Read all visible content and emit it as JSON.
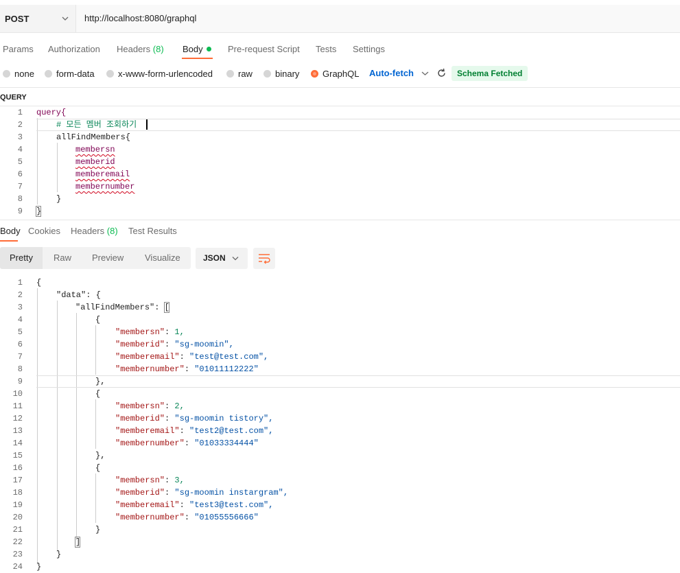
{
  "request": {
    "method": "POST",
    "url": "http://localhost:8080/graphql"
  },
  "tabs": [
    {
      "label": "Params"
    },
    {
      "label": "Authorization"
    },
    {
      "label": "Headers",
      "count": "(8)"
    },
    {
      "label": "Body"
    },
    {
      "label": "Pre-request Script"
    },
    {
      "label": "Tests"
    },
    {
      "label": "Settings"
    }
  ],
  "body_types": [
    "none",
    "form-data",
    "x-www-form-urlencoded",
    "raw",
    "binary",
    "GraphQL"
  ],
  "selected_body_type": "GraphQL",
  "auto_fetch": "Auto-fetch",
  "schema_badge": "Schema Fetched",
  "query_label": "QUERY",
  "query_lines": [
    {
      "n": "1",
      "text": "query{"
    },
    {
      "n": "2",
      "text": "# 모든 멤버 조회하기"
    },
    {
      "n": "3",
      "text": "allFindMembers{"
    },
    {
      "n": "4",
      "text": "membersn"
    },
    {
      "n": "5",
      "text": "memberid"
    },
    {
      "n": "6",
      "text": "memberemail"
    },
    {
      "n": "7",
      "text": "membernumber"
    },
    {
      "n": "8",
      "text": "}"
    },
    {
      "n": "9",
      "text": "}"
    }
  ],
  "response_tabs": [
    {
      "label": "Body"
    },
    {
      "label": "Cookies"
    },
    {
      "label": "Headers",
      "count": "(8)"
    },
    {
      "label": "Test Results"
    }
  ],
  "view_modes": [
    "Pretty",
    "Raw",
    "Preview",
    "Visualize"
  ],
  "format": "JSON",
  "response_lines": [
    {
      "n": "1",
      "text": "{"
    },
    {
      "n": "2",
      "text": "\"data\": {"
    },
    {
      "n": "3",
      "text": "\"allFindMembers\": ["
    },
    {
      "n": "4",
      "text": "{"
    },
    {
      "n": "5",
      "key": "\"membersn\"",
      "val": "1,"
    },
    {
      "n": "6",
      "key": "\"memberid\"",
      "val": "\"sg-moomin\","
    },
    {
      "n": "7",
      "key": "\"memberemail\"",
      "val": "\"test@test.com\","
    },
    {
      "n": "8",
      "key": "\"membernumber\"",
      "val": "\"01011112222\""
    },
    {
      "n": "9",
      "text": "},"
    },
    {
      "n": "10",
      "text": "{"
    },
    {
      "n": "11",
      "key": "\"membersn\"",
      "val": "2,"
    },
    {
      "n": "12",
      "key": "\"memberid\"",
      "val": "\"sg-moomin tistory\","
    },
    {
      "n": "13",
      "key": "\"memberemail\"",
      "val": "\"test2@test.com\","
    },
    {
      "n": "14",
      "key": "\"membernumber\"",
      "val": "\"01033334444\""
    },
    {
      "n": "15",
      "text": "},"
    },
    {
      "n": "16",
      "text": "{"
    },
    {
      "n": "17",
      "key": "\"membersn\"",
      "val": "3,"
    },
    {
      "n": "18",
      "key": "\"memberid\"",
      "val": "\"sg-moomin instargram\","
    },
    {
      "n": "19",
      "key": "\"memberemail\"",
      "val": "\"test3@test.com\","
    },
    {
      "n": "20",
      "key": "\"membernumber\"",
      "val": "\"01055556666\""
    },
    {
      "n": "21",
      "text": "}"
    },
    {
      "n": "22",
      "text": "]"
    },
    {
      "n": "23",
      "text": "}"
    },
    {
      "n": "24",
      "text": "}"
    }
  ],
  "colors": {
    "accent": "#ff6c37",
    "success": "#0cbb52",
    "link": "#0265d2",
    "json_key": "#a31515",
    "json_string": "#0451a5",
    "json_number": "#098658"
  }
}
